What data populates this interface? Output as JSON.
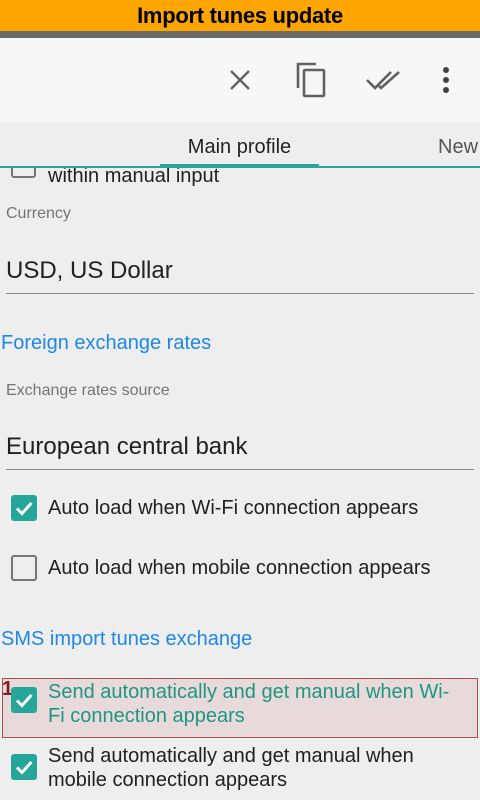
{
  "banner": {
    "title": "Import tunes update"
  },
  "toolbar": {
    "actions": [
      {
        "name": "close",
        "icon": "close-icon"
      },
      {
        "name": "copy",
        "icon": "copy-icon"
      },
      {
        "name": "done-all",
        "icon": "double-check-icon"
      },
      {
        "name": "more",
        "icon": "more-vert-icon"
      }
    ]
  },
  "tabs": {
    "main": "Main profile",
    "next": "New"
  },
  "content": {
    "partial_checkbox_label": "within manual input",
    "currency": {
      "label": "Currency",
      "value": "USD, US Dollar"
    },
    "fx_section": "Foreign exchange rates",
    "rates_source": {
      "label": "Exchange rates source",
      "value": "European central bank"
    },
    "auto_wifi": {
      "label": "Auto load when Wi-Fi connection appears",
      "checked": true
    },
    "auto_mobile": {
      "label": "Auto load when mobile connection appears",
      "checked": false
    },
    "sms_section": "SMS import tunes exchange",
    "send_wifi": {
      "line1": "Send automatically and get manual when Wi-",
      "line2": "Fi connection appears",
      "checked": true
    },
    "send_mobile": {
      "line1": "Send automatically and get manual when",
      "line2": "mobile connection appears",
      "checked": true
    },
    "highlight_number": "1"
  },
  "colors": {
    "accent": "#26a69a",
    "link": "#1e88e5",
    "banner": "#ffa500"
  }
}
